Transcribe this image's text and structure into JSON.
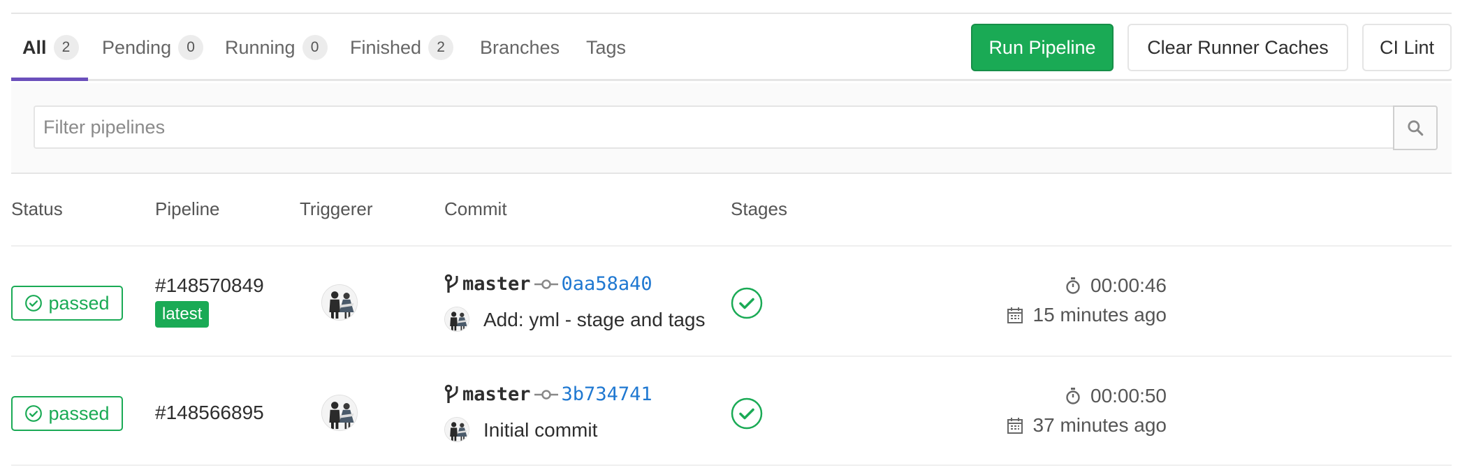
{
  "tabs": [
    {
      "label": "All",
      "count": "2"
    },
    {
      "label": "Pending",
      "count": "0"
    },
    {
      "label": "Running",
      "count": "0"
    },
    {
      "label": "Finished",
      "count": "2"
    },
    {
      "label": "Branches"
    },
    {
      "label": "Tags"
    }
  ],
  "actions": {
    "run_pipeline": "Run Pipeline",
    "clear_caches": "Clear Runner Caches",
    "ci_lint": "CI Lint"
  },
  "filter": {
    "placeholder": "Filter pipelines",
    "value": ""
  },
  "columns": [
    "Status",
    "Pipeline",
    "Triggerer",
    "Commit",
    "Stages"
  ],
  "colors": {
    "success": "#1aaa55",
    "link": "#1f78d1",
    "tab_active": "#6b4fbb"
  },
  "pipelines": [
    {
      "status": "passed",
      "id": "#148570849",
      "badge": "latest",
      "branch": "master",
      "sha": "0aa58a40",
      "message": "Add: yml - stage and tags",
      "duration": "00:00:46",
      "finished": "15 minutes ago"
    },
    {
      "status": "passed",
      "id": "#148566895",
      "branch": "master",
      "sha": "3b734741",
      "message": "Initial commit",
      "duration": "00:00:50",
      "finished": "37 minutes ago"
    }
  ]
}
